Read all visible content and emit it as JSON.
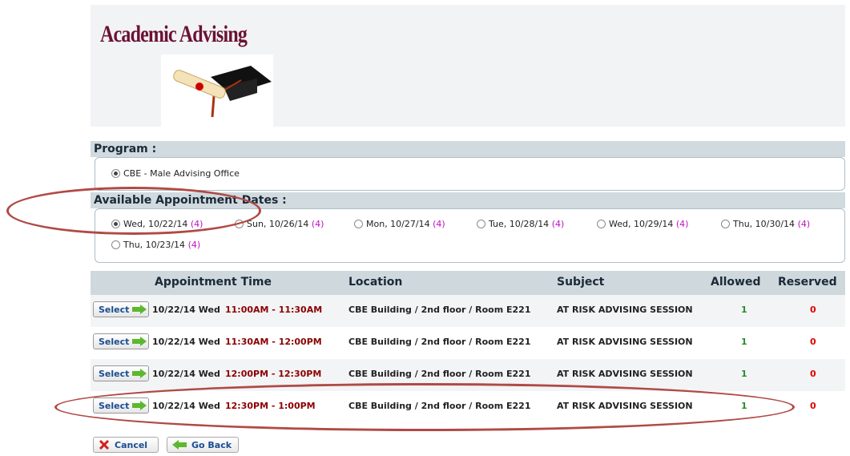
{
  "header": {
    "title": "Academic Advising"
  },
  "program": {
    "label": "Program :",
    "option": "CBE - Male Advising Office"
  },
  "dates": {
    "label": "Available Appointment Dates :",
    "options": [
      {
        "date": "Wed, 10/22/14",
        "count": "(4)"
      },
      {
        "date": "Sun, 10/26/14",
        "count": "(4)"
      },
      {
        "date": "Mon, 10/27/14",
        "count": "(4)"
      },
      {
        "date": "Tue, 10/28/14",
        "count": "(4)"
      },
      {
        "date": "Wed, 10/29/14",
        "count": "(4)"
      },
      {
        "date": "Thu, 10/30/14",
        "count": "(4)"
      },
      {
        "date": "Thu, 10/23/14",
        "count": "(4)"
      }
    ]
  },
  "table": {
    "headers": [
      "Appointment Time",
      "Location",
      "Subject",
      "Allowed",
      "Reserved"
    ],
    "select_label": "Select",
    "rows": [
      {
        "date": "10/22/14 Wed",
        "time": "11:00AM - 11:30AM",
        "location": "CBE Building / 2nd floor / Room E221",
        "subject": "AT RISK ADVISING SESSION",
        "allowed": "1",
        "reserved": "0"
      },
      {
        "date": "10/22/14 Wed",
        "time": "11:30AM - 12:00PM",
        "location": "CBE Building / 2nd floor / Room E221",
        "subject": "AT RISK ADVISING SESSION",
        "allowed": "1",
        "reserved": "0"
      },
      {
        "date": "10/22/14 Wed",
        "time": "12:00PM - 12:30PM",
        "location": "CBE Building / 2nd floor / Room E221",
        "subject": "AT RISK ADVISING SESSION",
        "allowed": "1",
        "reserved": "0"
      },
      {
        "date": "10/22/14 Wed",
        "time": "12:30PM - 1:00PM",
        "location": "CBE Building / 2nd floor / Room E221",
        "subject": "AT RISK ADVISING SESSION",
        "allowed": "1",
        "reserved": "0"
      }
    ]
  },
  "buttons": {
    "cancel": "Cancel",
    "go_back": "Go Back"
  },
  "colors": {
    "title": "#6b1233",
    "count": "#c010c0",
    "annotation": "#b04a45",
    "allowed": "#2a8a2a",
    "reserved": "#e00000"
  }
}
